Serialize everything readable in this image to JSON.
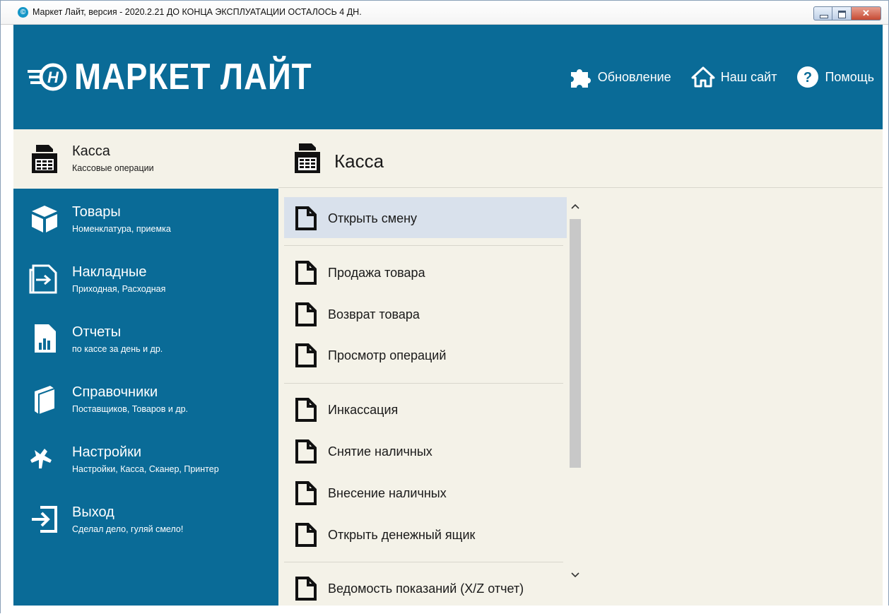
{
  "window": {
    "title": "Маркет Лайт, версия - 2020.2.21  ДО КОНЦА ЭКСПЛУАТАЦИИ ОСТАЛОСЬ 4 ДН."
  },
  "header": {
    "logo_text": "МАРКЕТ ЛАЙТ",
    "nav": [
      {
        "label": "Обновление",
        "icon": "puzzle-icon"
      },
      {
        "label": "Наш сайт",
        "icon": "home-icon"
      },
      {
        "label": "Помощь",
        "icon": "help-icon"
      }
    ]
  },
  "sidebar": {
    "items": [
      {
        "title": "Касса",
        "subtitle": "Кассовые операции",
        "icon": "cash-register-icon",
        "active": true
      },
      {
        "title": "Товары",
        "subtitle": "Номенклатура, приемка",
        "icon": "box-icon"
      },
      {
        "title": "Накладные",
        "subtitle": "Приходная, Расходная",
        "icon": "invoice-icon"
      },
      {
        "title": "Отчеты",
        "subtitle": "по кассе за день и др.",
        "icon": "report-icon"
      },
      {
        "title": "Справочники",
        "subtitle": "Поставщиков, Товаров и др.",
        "icon": "book-icon"
      },
      {
        "title": "Настройки",
        "subtitle": "Настройки, Касса, Сканер, Принтер",
        "icon": "settings-icon"
      },
      {
        "title": "Выход",
        "subtitle": "Сделал дело, гуляй смело!",
        "icon": "exit-icon"
      }
    ]
  },
  "main": {
    "title": "Касса",
    "menu": [
      {
        "label": "Открыть смену",
        "selected": true
      },
      {
        "label": "Продажа товара"
      },
      {
        "label": "Возврат товара"
      },
      {
        "label": "Просмотр операций"
      },
      {
        "label": "Инкассация"
      },
      {
        "label": "Снятие наличных"
      },
      {
        "label": "Внесение наличных"
      },
      {
        "label": "Открыть денежный ящик"
      },
      {
        "label": "Ведомость показаний (X/Z отчет)"
      }
    ]
  },
  "colors": {
    "brand": "#0a6b97",
    "background": "#f4f2e8",
    "selected_row": "#d9e1ec"
  }
}
